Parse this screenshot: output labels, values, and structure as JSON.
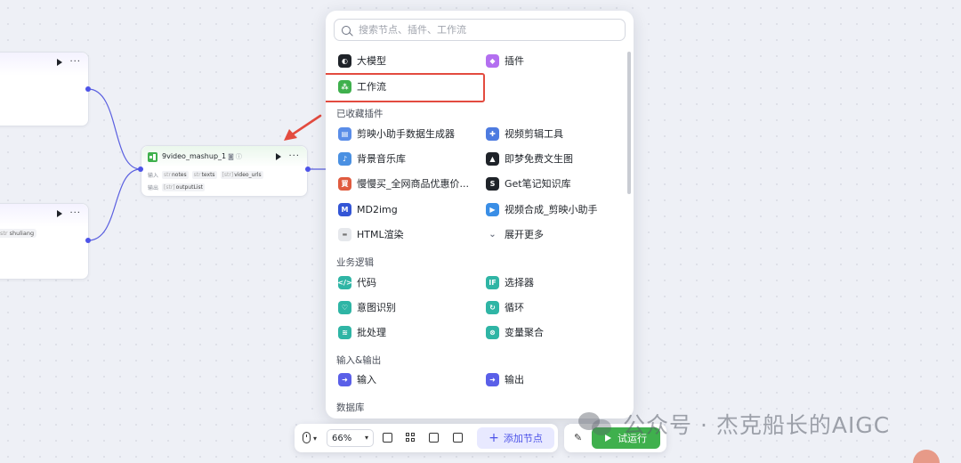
{
  "canvas": {
    "node_b_param": {
      "type_prefix": "str",
      "name": "shuliang"
    },
    "main_node": {
      "title": "9video_mashup_1",
      "input_label": "输入",
      "output_label": "输出",
      "inputs": [
        {
          "type_prefix": "str",
          "name": "notes"
        },
        {
          "type_prefix": "str",
          "name": "texts"
        },
        {
          "type_prefix": "[str]",
          "name": "video_urls"
        }
      ],
      "output": {
        "type_prefix": "[str]",
        "name": "outputList"
      }
    }
  },
  "panel": {
    "search_placeholder": "搜索节点、插件、工作流",
    "top_items": [
      {
        "label": "大模型",
        "icon": "llm-icon",
        "color": "#1f2329"
      },
      {
        "label": "插件",
        "icon": "plugin-icon",
        "color": "#b36ff0"
      },
      {
        "label": "工作流",
        "icon": "workflow-icon",
        "color": "#3fb04d"
      }
    ],
    "favorites_title": "已收藏插件",
    "favorites": [
      {
        "label": "剪映小助手数据生成器",
        "icon": "jianying-data-icon",
        "color": "#5a8de8"
      },
      {
        "label": "视频剪辑工具",
        "icon": "video-edit-icon",
        "color": "#4d7be0"
      },
      {
        "label": "背景音乐库",
        "icon": "music-library-icon",
        "color": "#4a90e2"
      },
      {
        "label": "即梦免费文生图",
        "icon": "jimeng-icon",
        "color": "#1f2329"
      },
      {
        "label": "慢慢买_全网商品优惠价...",
        "icon": "manmanmai-icon",
        "color": "#e05b3f"
      },
      {
        "label": "Get笔记知识库",
        "icon": "get-notes-icon",
        "color": "#1f2329"
      },
      {
        "label": "MD2img",
        "icon": "md2img-icon",
        "color": "#3355d6"
      },
      {
        "label": "视频合成_剪映小助手",
        "icon": "video-compose-icon",
        "color": "#3a8ee6"
      },
      {
        "label": "HTML渲染",
        "icon": "html-render-icon",
        "color": "#9aa0ab"
      },
      {
        "label": "展开更多",
        "icon": "chevron-down-icon",
        "color": "#6b7180"
      }
    ],
    "logic_title": "业务逻辑",
    "logic": [
      {
        "label": "代码",
        "icon": "code-icon",
        "color": "#2fb5a5"
      },
      {
        "label": "选择器",
        "icon": "condition-icon",
        "color": "#2fb5a5"
      },
      {
        "label": "意图识别",
        "icon": "intent-icon",
        "color": "#2fb5a5"
      },
      {
        "label": "循环",
        "icon": "loop-icon",
        "color": "#2fb5a5"
      },
      {
        "label": "批处理",
        "icon": "batch-icon",
        "color": "#2fb5a5"
      },
      {
        "label": "变量聚合",
        "icon": "variable-merge-icon",
        "color": "#2fb5a5"
      }
    ],
    "io_title": "输入&输出",
    "io": [
      {
        "label": "输入",
        "icon": "input-icon",
        "color": "#5a5fe8"
      },
      {
        "label": "输出",
        "icon": "output-icon",
        "color": "#5a5fe8"
      }
    ],
    "db_title": "数据库"
  },
  "toolbar": {
    "zoom": "66%",
    "add_node": "添加节点",
    "run": "试运行"
  },
  "watermark": "公众号 · 杰克船长的AIGC",
  "accent": "#4d53e8",
  "highlight_color": "#e34b3f"
}
